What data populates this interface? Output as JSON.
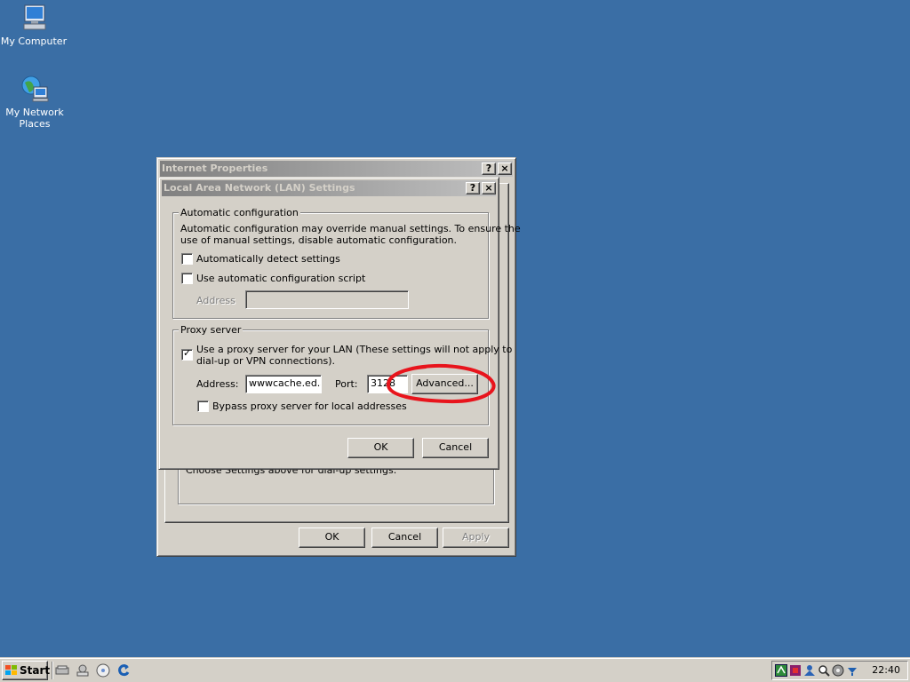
{
  "desktop": {
    "icons": [
      {
        "label": "My Computer"
      },
      {
        "label": "My Network Places"
      }
    ]
  },
  "internet_properties": {
    "title": "Internet Properties",
    "help_glyph": "?",
    "close_glyph": "×",
    "dialup_note": "Choose Settings above for dial-up settings.",
    "ok_label": "OK",
    "cancel_label": "Cancel",
    "apply_label": "Apply"
  },
  "lan_dialog": {
    "title": "Local Area Network (LAN) Settings",
    "help_glyph": "?",
    "close_glyph": "×",
    "auto_config": {
      "legend": "Automatic configuration",
      "description_line1": "Automatic configuration may override manual settings.  To ensure the",
      "description_line2": "use of manual settings, disable automatic configuration.",
      "auto_detect_label": "Automatically detect settings",
      "auto_detect_checked": false,
      "script_label": "Use automatic configuration script",
      "script_checked": false,
      "address_label": "Address",
      "address_value": ""
    },
    "proxy": {
      "legend": "Proxy server",
      "use_proxy_line1": "Use a proxy server for your LAN (These settings will not apply to",
      "use_proxy_line2": "dial-up or VPN connections).",
      "use_proxy_checked": true,
      "address_label": "Address:",
      "address_value": "wwwcache.ed.a",
      "port_label": "Port:",
      "port_value": "3128",
      "advanced_label": "Advanced...",
      "bypass_label": "Bypass proxy server for local addresses",
      "bypass_checked": false
    },
    "ok_label": "OK",
    "cancel_label": "Cancel",
    "check_glyph": "✓"
  },
  "annotation": {
    "color": "#e8141c"
  },
  "taskbar": {
    "start_label": "Start",
    "quick_launch": [
      "show-desktop-icon",
      "server-management-icon",
      "media-player-icon",
      "refresh-icon"
    ],
    "tray_icons": [
      "network-icon",
      "security-icon",
      "users-icon",
      "search-icon",
      "volume-icon",
      "connection-icon"
    ],
    "clock": "22:40"
  },
  "colors": {
    "desktop": "#3a6ea5",
    "face": "#d4d0c8",
    "inactive_title_start": "#808080",
    "inactive_title_end": "#c0c0c0"
  }
}
